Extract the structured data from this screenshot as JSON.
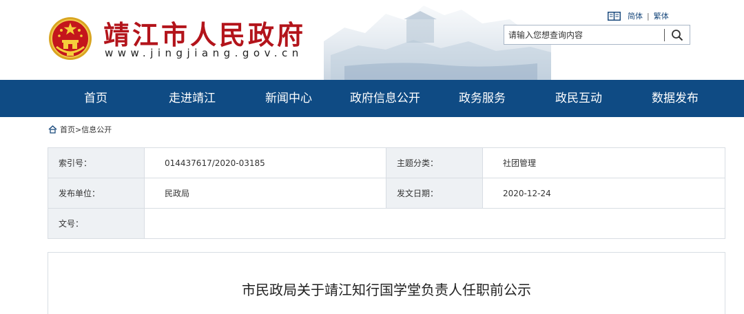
{
  "header": {
    "site_title": "靖江市人民政府",
    "site_url": "www.jingjiang.gov.cn",
    "lang": {
      "simplified": "简体",
      "separator": "|",
      "traditional": "繁体"
    },
    "search": {
      "placeholder": "请输入您想查询内容"
    }
  },
  "nav": {
    "items": [
      {
        "label": "首页"
      },
      {
        "label": "走进靖江"
      },
      {
        "label": "新闻中心"
      },
      {
        "label": "政府信息公开"
      },
      {
        "label": "政务服务"
      },
      {
        "label": "政民互动"
      },
      {
        "label": "数据发布"
      }
    ]
  },
  "breadcrumb": {
    "home": "首页",
    "separator": ">",
    "current": "信息公开"
  },
  "meta": {
    "index_label": "索引号：",
    "index_value": "014437617/2020-03185",
    "topic_label": "主题分类：",
    "topic_value": "社团管理",
    "publisher_label": "发布单位：",
    "publisher_value": "民政局",
    "date_label": "发文日期：",
    "date_value": "2020-12-24",
    "docno_label": "文号：",
    "docno_value": ""
  },
  "article": {
    "title": "市民政局关于靖江知行国学堂负责人任职前公示"
  },
  "colors": {
    "nav_bg": "#0f4b84",
    "title_red": "#b3141b",
    "label_bg": "#eef1f4"
  },
  "icons": [
    "national-emblem-icon",
    "book-icon",
    "search-icon",
    "home-icon"
  ]
}
